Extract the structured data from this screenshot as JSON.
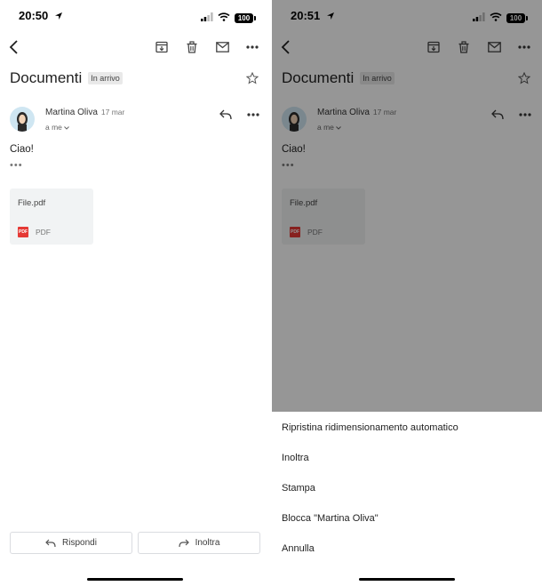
{
  "status_left": {
    "time": "20:50",
    "battery": "100"
  },
  "status_right": {
    "time": "20:51",
    "battery": "100"
  },
  "email": {
    "subject": "Documenti",
    "label": "In arrivo",
    "sender_name": "Martina Oliva",
    "date": "17 mar",
    "recipient": "a me",
    "body": "Ciao!",
    "quoted_indicator": "•••",
    "attachment": {
      "name": "File.pdf",
      "type": "PDF",
      "badge": "PDF"
    }
  },
  "actions": {
    "reply": "Rispondi",
    "forward": "Inoltra"
  },
  "menu": {
    "items": [
      "Ripristina ridimensionamento automatico",
      "Inoltra",
      "Stampa",
      "Blocca \"Martina Oliva\"",
      "Annulla"
    ]
  },
  "icons": {
    "back": "chevron-left-icon",
    "archive": "archive-icon",
    "delete": "trash-icon",
    "mark_unread": "mail-icon",
    "more": "more-horizontal-icon",
    "star": "star-outline-icon",
    "reply": "reply-icon",
    "forward": "forward-icon"
  },
  "colors": {
    "overlay": "#000000",
    "pdf_badge": "#e53935",
    "chip_bg": "#e9e9e9"
  }
}
